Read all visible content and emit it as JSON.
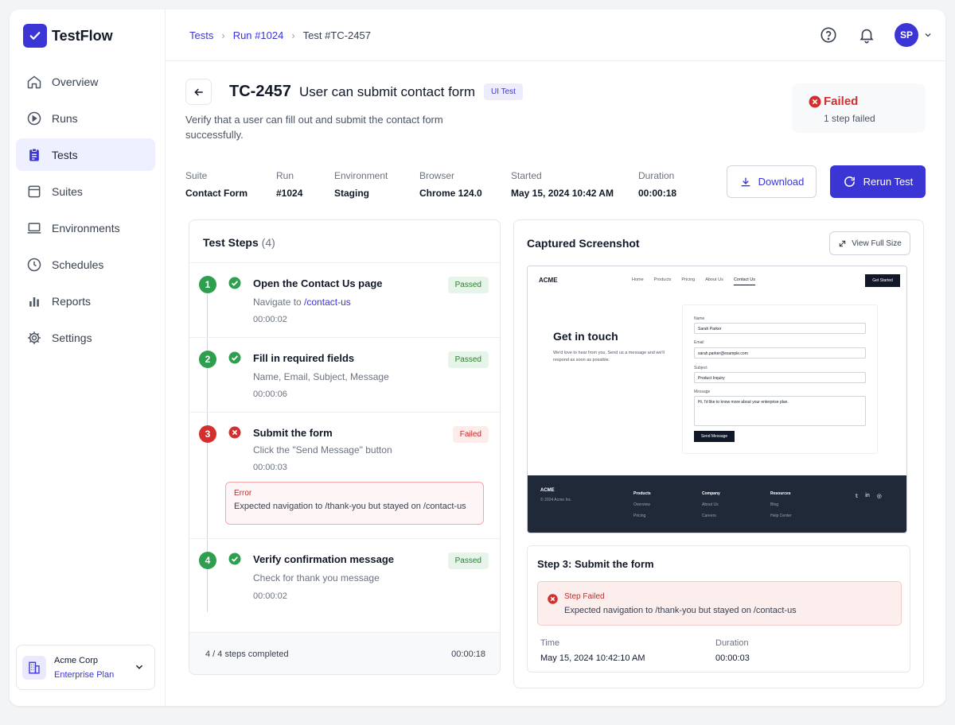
{
  "app": {
    "name": "TestFlow"
  },
  "sidebar": {
    "items": [
      {
        "label": "Overview",
        "icon": "home-icon"
      },
      {
        "label": "Runs",
        "icon": "play-circle-icon"
      },
      {
        "label": "Tests",
        "icon": "clipboard-icon",
        "active": true
      },
      {
        "label": "Suites",
        "icon": "folder-icon"
      },
      {
        "label": "Environments",
        "icon": "laptop-icon"
      },
      {
        "label": "Schedules",
        "icon": "clock-icon"
      },
      {
        "label": "Reports",
        "icon": "bar-chart-icon"
      },
      {
        "label": "Settings",
        "icon": "gear-icon"
      }
    ],
    "org": {
      "name": "Acme Corp",
      "plan": "Enterprise Plan"
    }
  },
  "topbar": {
    "breadcrumbs": [
      "Tests",
      "Run #1024",
      "Test #TC-2457"
    ],
    "avatar_initials": "SP"
  },
  "test": {
    "id": "TC-2457",
    "title": "User can submit contact form",
    "type_badge": "UI Test",
    "description": "Verify that a user can fill out and submit the contact form successfully.",
    "status": {
      "label": "Failed",
      "sub": "1 step failed",
      "color": "#d32f2f"
    },
    "meta": [
      {
        "label": "Suite",
        "value": "Contact Form"
      },
      {
        "label": "Run",
        "value": "#1024"
      },
      {
        "label": "Environment",
        "value": "Staging"
      },
      {
        "label": "Browser",
        "value": "Chrome 124.0"
      },
      {
        "label": "Started",
        "value": "May 15, 2024 10:42 AM"
      },
      {
        "label": "Duration",
        "value": "00:00:18"
      }
    ],
    "actions": {
      "download": "Download",
      "rerun": "Rerun Test"
    }
  },
  "steps": {
    "heading": "Test Steps",
    "count": "(4)",
    "items": [
      {
        "num": "1",
        "title": "Open the Contact Us page",
        "sub_prefix": "Navigate to ",
        "sub_link": "/contact-us",
        "time": "00:00:02",
        "status": "Passed"
      },
      {
        "num": "2",
        "title": "Fill in required fields",
        "sub": "Name, Email, Subject, Message",
        "time": "00:00:06",
        "status": "Passed"
      },
      {
        "num": "3",
        "title": "Submit the form",
        "sub": "Click the \"Send Message\" button",
        "time": "00:00:03",
        "status": "Failed",
        "error_label": "Error",
        "error_text": "Expected navigation to /thank-you but stayed on /contact-us"
      },
      {
        "num": "4",
        "title": "Verify confirmation message",
        "sub": "Check for thank you message",
        "time": "00:00:02",
        "status": "Passed"
      }
    ],
    "footer_left": "4 / 4 steps completed",
    "footer_right": "00:00:18"
  },
  "screenshot": {
    "title": "Captured Screenshot",
    "view_full": "View Full Size",
    "mock": {
      "logo": "ACME",
      "nav": [
        "Home",
        "Products",
        "Pricing",
        "About Us",
        "Contact Us"
      ],
      "cta": "Get Started",
      "heading": "Get in touch",
      "paragraph": "We'd love to hear from you. Send us a message and we'll respond as soon as possible.",
      "fields": [
        {
          "label": "Name",
          "value": "Sarah Parker"
        },
        {
          "label": "Email",
          "value": "sarah.parker@example.com"
        },
        {
          "label": "Subject",
          "value": "Product Inquiry"
        },
        {
          "label": "Message",
          "value": "Hi, I'd like to know more about your enterprise plan."
        }
      ],
      "send": "Send Message",
      "footer_logo": "ACME",
      "footer_copy": "© 2024 Acme Inc.",
      "footer_cols": [
        {
          "head": "Products",
          "items": [
            "Overview",
            "Pricing"
          ]
        },
        {
          "head": "Company",
          "items": [
            "About Us",
            "Careers"
          ]
        },
        {
          "head": "Resources",
          "items": [
            "Blog",
            "Help Center"
          ]
        }
      ]
    },
    "detail": {
      "title": "Step 3: Submit the form",
      "err_label": "Step Failed",
      "err_text": "Expected navigation to /thank-you but stayed on /contact-us",
      "time_label": "Time",
      "time_value": "May 15, 2024 10:42:10 AM",
      "duration_label": "Duration",
      "duration_value": "00:00:03"
    }
  },
  "colors": {
    "accent": "#3b35d6",
    "pass": "#2e9e4f",
    "fail": "#d32f2f"
  }
}
